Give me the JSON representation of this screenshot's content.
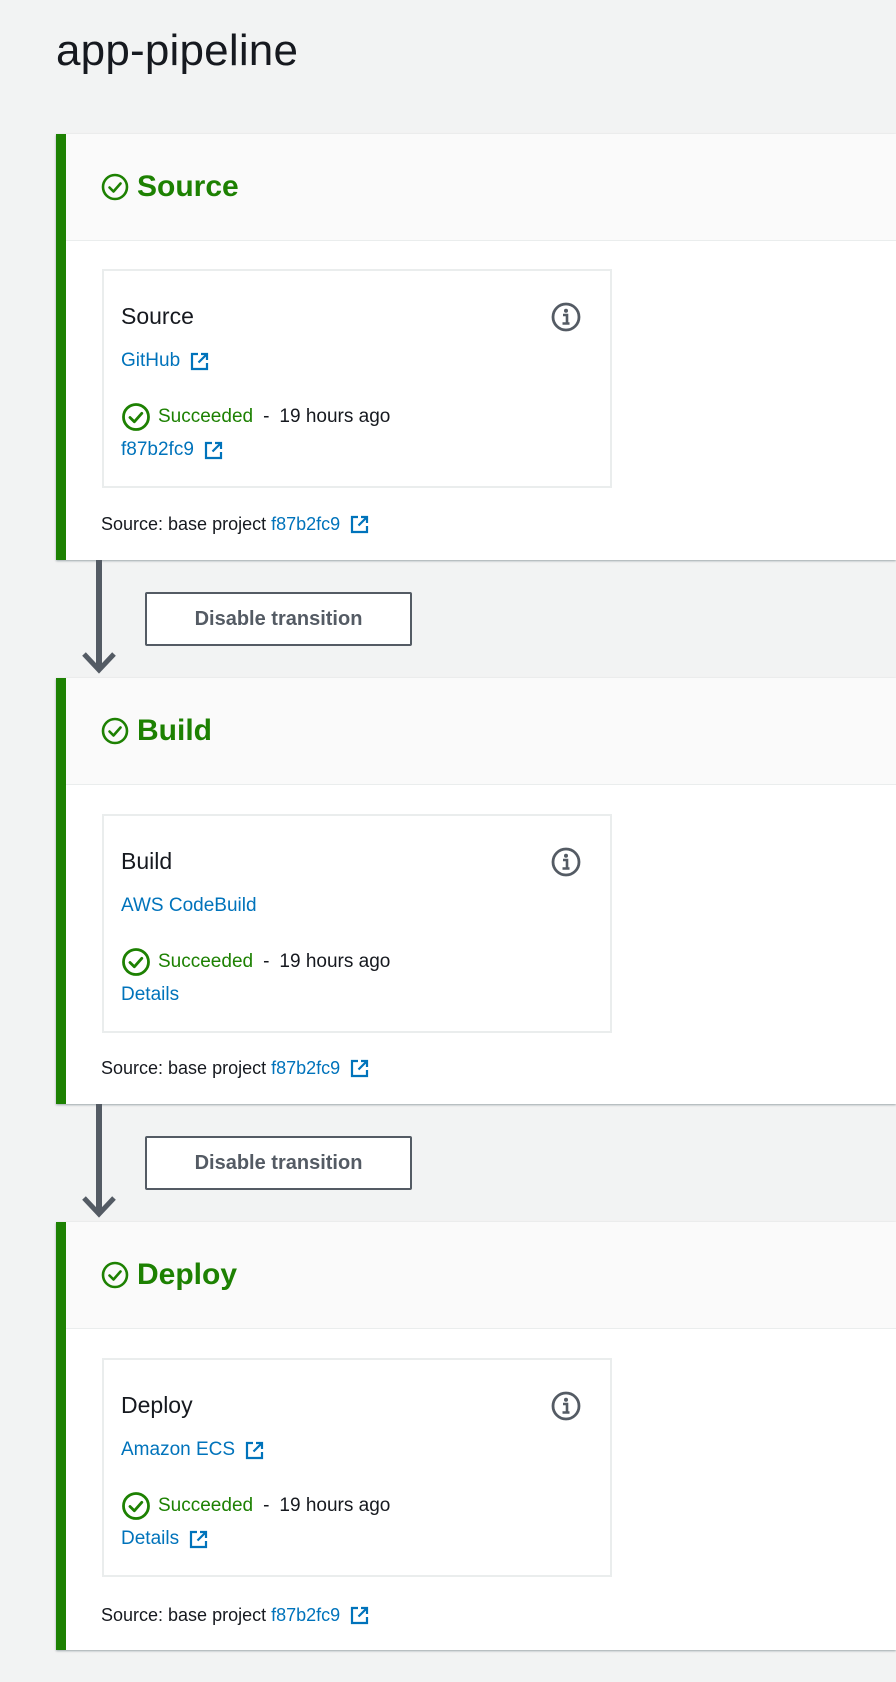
{
  "page": {
    "title": "app-pipeline"
  },
  "colors": {
    "success": "#1d8102",
    "link": "#0073bb",
    "text": "#16191f",
    "border": "#545b64"
  },
  "stages": [
    {
      "name": "Source",
      "status_icon": "check-circle-icon",
      "action": {
        "name": "Source",
        "provider": "GitHub",
        "provider_external": true,
        "status": "Succeeded",
        "separator": "-",
        "time": "19 hours ago",
        "detail_link": "f87b2fc9",
        "detail_external": true
      },
      "source_label": "Source: base project",
      "source_commit": "f87b2fc9"
    },
    {
      "name": "Build",
      "status_icon": "check-circle-icon",
      "action": {
        "name": "Build",
        "provider": "AWS CodeBuild",
        "provider_external": false,
        "status": "Succeeded",
        "separator": "-",
        "time": "19 hours ago",
        "detail_link": "Details",
        "detail_external": false
      },
      "source_label": "Source: base project",
      "source_commit": "f87b2fc9"
    },
    {
      "name": "Deploy",
      "status_icon": "check-circle-icon",
      "action": {
        "name": "Deploy",
        "provider": "Amazon ECS",
        "provider_external": true,
        "status": "Succeeded",
        "separator": "-",
        "time": "19 hours ago",
        "detail_link": "Details",
        "detail_external": true
      },
      "source_label": "Source: base project",
      "source_commit": "f87b2fc9"
    }
  ],
  "transitions": [
    {
      "button_label": "Disable transition"
    },
    {
      "button_label": "Disable transition"
    }
  ]
}
